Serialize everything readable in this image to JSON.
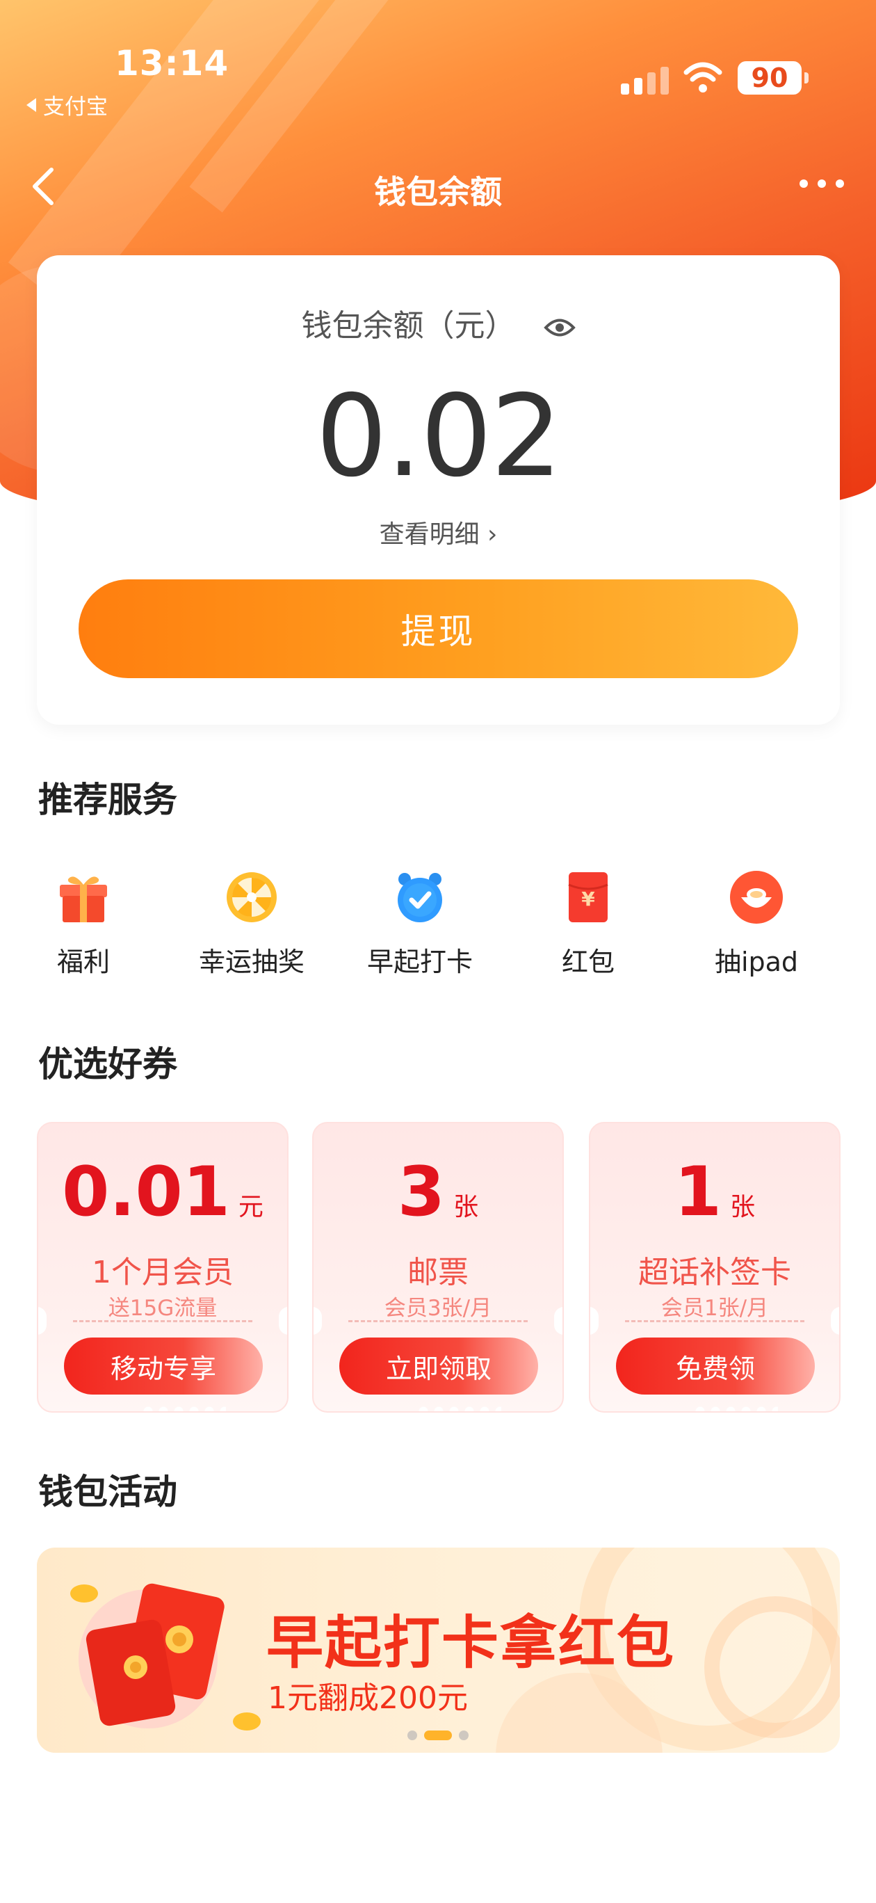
{
  "status_bar": {
    "time": "13:14",
    "back_app": "支付宝",
    "battery": "90"
  },
  "navbar": {
    "title": "钱包余额"
  },
  "balance": {
    "label": "钱包余额（元）",
    "amount": "0.02",
    "detail_link": "查看明细 ›",
    "withdraw_label": "提现"
  },
  "services": {
    "title": "推荐服务",
    "items": [
      {
        "label": "福利",
        "icon": "gift-icon"
      },
      {
        "label": "幸运抽奖",
        "icon": "lottery-wheel-icon"
      },
      {
        "label": "早起打卡",
        "icon": "alarm-clock-icon"
      },
      {
        "label": "红包",
        "icon": "red-envelope-icon"
      },
      {
        "label": "抽ipad",
        "icon": "ingot-icon"
      }
    ]
  },
  "coupons": {
    "title": "优选好券",
    "items": [
      {
        "value": "0.01",
        "unit": "元",
        "title": "1个月会员",
        "subtitle": "送15G流量",
        "button": "移动专享"
      },
      {
        "value": "3",
        "unit": "张",
        "title": "邮票",
        "subtitle": "会员3张/月",
        "button": "立即领取"
      },
      {
        "value": "1",
        "unit": "张",
        "title": "超话补签卡",
        "subtitle": "会员1张/月",
        "button": "免费领"
      }
    ]
  },
  "activities": {
    "title": "钱包活动",
    "banner": {
      "title": "早起打卡拿红包",
      "subtitle": "1元翻成200元"
    },
    "carousel": {
      "count": 3,
      "active_index": 1
    }
  },
  "colors": {
    "accent_orange": "#ff8c1a",
    "brand_red": "#e2141e",
    "hero_end": "#ea3410"
  }
}
